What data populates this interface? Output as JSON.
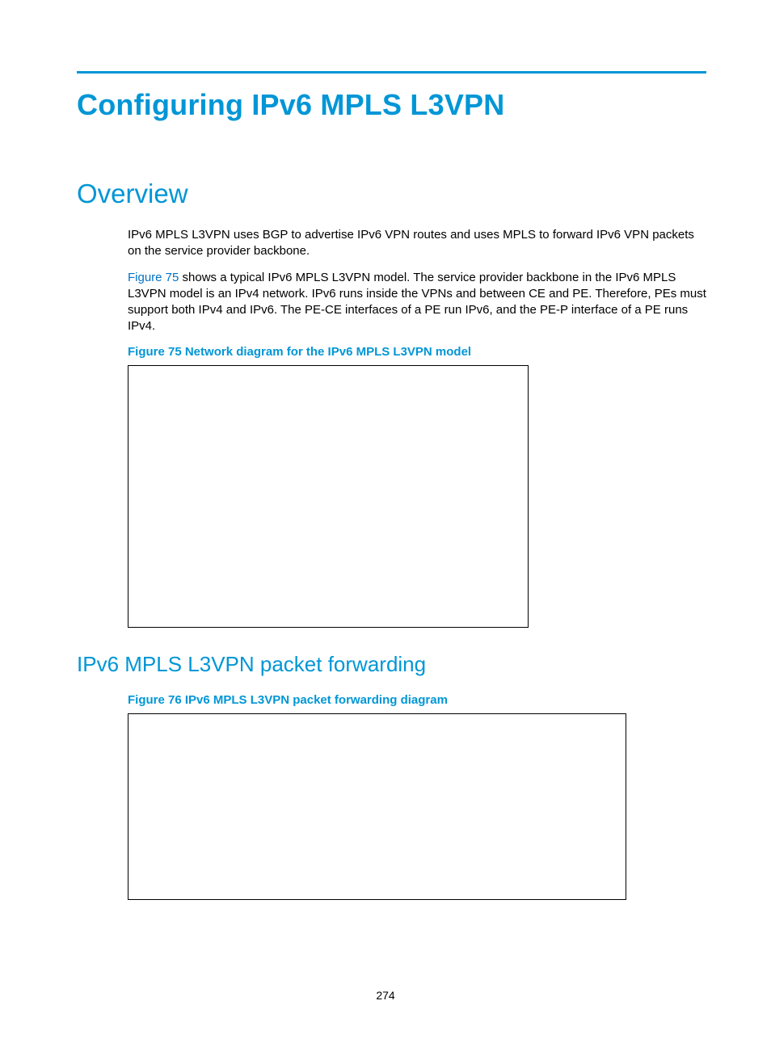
{
  "title": "Configuring IPv6 MPLS L3VPN",
  "overview": {
    "heading": "Overview",
    "para1": "IPv6 MPLS L3VPN uses BGP to advertise IPv6 VPN routes and uses MPLS to forward IPv6 VPN packets on the service provider backbone.",
    "para2_link": "Figure 75",
    "para2_rest": " shows a typical IPv6 MPLS L3VPN model. The service provider backbone in the IPv6 MPLS L3VPN model is an IPv4 network. IPv6 runs inside the VPNs and between CE and PE. Therefore, PEs must support both IPv4 and IPv6. The PE-CE interfaces of a PE run IPv6, and the PE-P interface of a PE runs IPv4.",
    "fig75_caption": "Figure 75 Network diagram for the IPv6 MPLS L3VPN model"
  },
  "forwarding": {
    "heading": "IPv6 MPLS L3VPN packet forwarding",
    "fig76_caption": "Figure 76 IPv6 MPLS L3VPN packet forwarding diagram"
  },
  "page_number": "274"
}
